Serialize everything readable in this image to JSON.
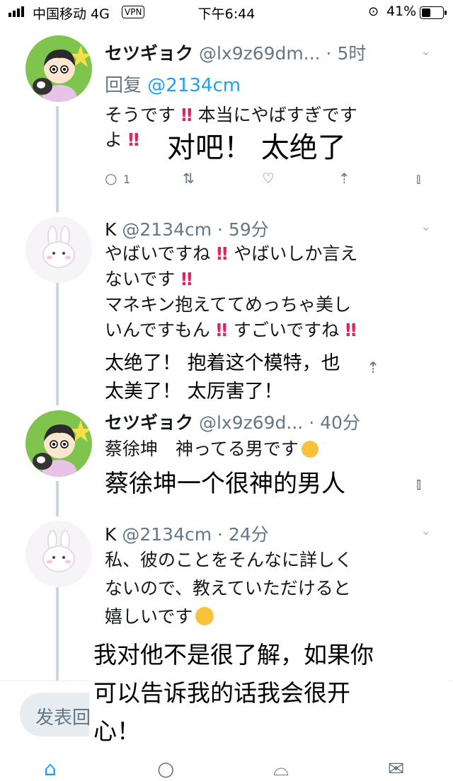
{
  "status_bar": {
    "carrier": "中国移动 4G",
    "vpn": "VPN",
    "time": "下午6:44",
    "battery": "41%"
  },
  "tweets": [
    {
      "display_name": "セツギョク",
      "handle_time": "@lx9z69dm... · 5时",
      "reply_prefix": "回复",
      "reply_mention": "@2134cm",
      "text": "そうです",
      "text_2": "本当にやばすぎです",
      "text_3": "よ",
      "caption": "对吧！ 太绝了",
      "reply_count": "1"
    },
    {
      "display_name": "K",
      "handle_time": "@2134cm · 59分",
      "l1a": "やばいですね",
      "l1b": "やばいしか言え",
      "l2a": "ないです",
      "l3": "マネキン抱えててめっちゃ美し",
      "l4a": "いんですもん",
      "l4b": "すごいですね",
      "caption": "太绝了！ 抱着这个模特，也\n太美了！ 太厉害了！"
    },
    {
      "display_name": "セツギョク",
      "handle_time": "@lx9z69d... · 40分",
      "text": "蔡徐坤　神ってる男です",
      "caption": "蔡徐坤一个很神的男人"
    },
    {
      "display_name": "K",
      "handle_time": "@2134cm · 24分",
      "text": "私、彼のことをそんなに詳しく\nないので、教えていただけると\n嬉しいです",
      "caption": "我对他不是很了解，如果你\n可以告诉我的话我会很开\n心！"
    }
  ],
  "reply_bar": {
    "placeholder": "发表回"
  }
}
